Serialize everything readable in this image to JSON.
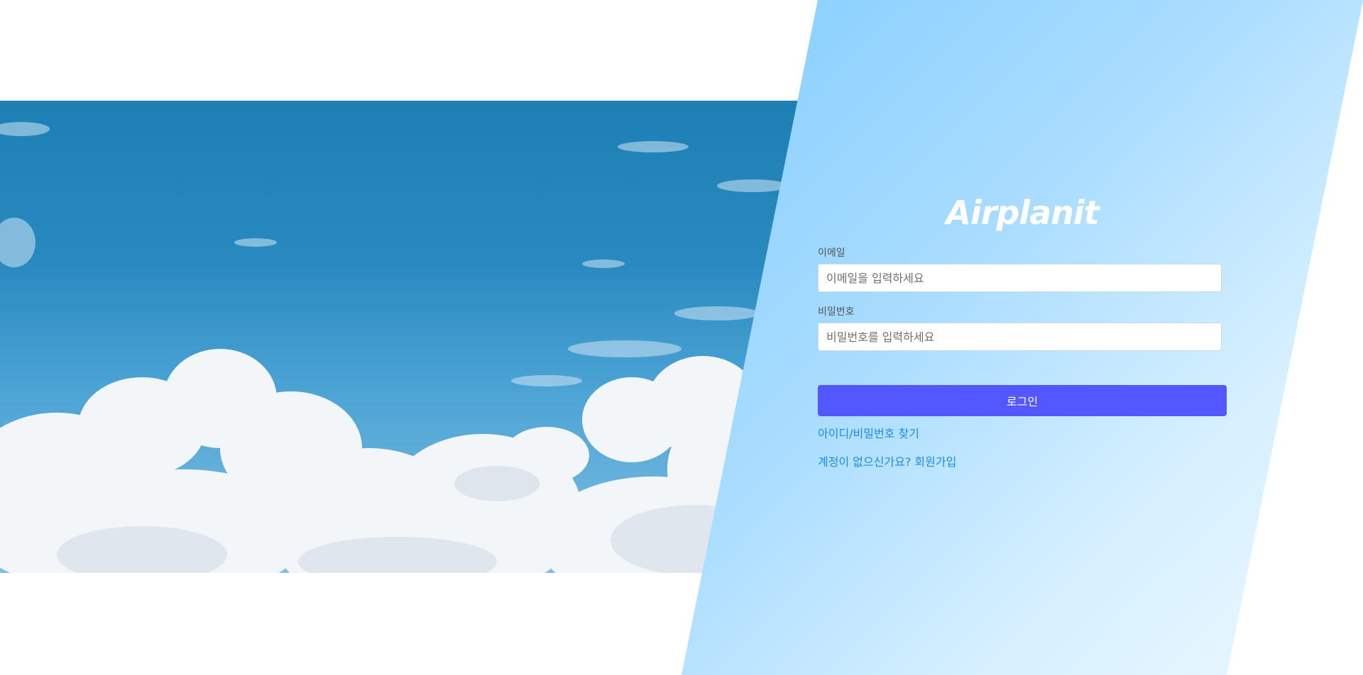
{
  "brand": {
    "logo_text": "Airplanit"
  },
  "form": {
    "email_label": "이메일",
    "email_placeholder": "이메일을 입력하세요",
    "password_label": "비밀번호",
    "password_placeholder": "비밀번호를 입력하세요",
    "login_button": "로그인"
  },
  "links": {
    "find_account": "아이디/비밀번호 찾기",
    "signup": "계정이 없으신가요? 회원가입"
  },
  "colors": {
    "panel_start": "#4fb6ff",
    "panel_end": "#eef8ff",
    "button": "#5257ff",
    "link": "#1a8cf0",
    "sky": "#1d7fb3"
  }
}
